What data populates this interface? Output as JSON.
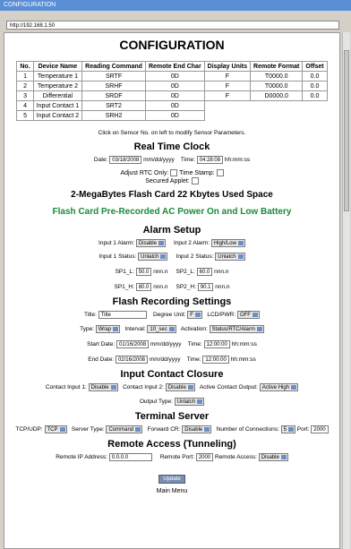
{
  "window": {
    "title": "CONFIGURATION"
  },
  "address": {
    "url": "http://192.168.1.50"
  },
  "page_title": "CONFIGURATION",
  "sensors": {
    "headers": [
      "No.",
      "Device Name",
      "Reading Command",
      "Remote End Char",
      "Display Units",
      "Remote Format",
      "Offset"
    ],
    "rows": [
      [
        "1",
        "Temperature 1",
        "SRTF",
        "0D",
        "F",
        "T0000.0",
        "0.0"
      ],
      [
        "2",
        "Temperature 2",
        "SRHF",
        "0D",
        "F",
        "T0000.0",
        "0.0"
      ],
      [
        "3",
        "Differential",
        "SRDF",
        "0D",
        "F",
        "D0000.0",
        "0.0"
      ],
      [
        "4",
        "Input Contact 1",
        "SRT2",
        "0D"
      ],
      [
        "5",
        "Input Contact 2",
        "SRH2",
        "0D"
      ]
    ],
    "note": "Click on Sensor No. on left to modify Sensor Parameters."
  },
  "rtc": {
    "title": "Real Time Clock",
    "date_label": "Date:",
    "date_value": "03/18/2008",
    "date_fmt": "mm/dd/yyyy",
    "time_label": "Time:",
    "time_value": "04:28:08",
    "time_fmt": "hh:mm:ss",
    "adjust_label": "Adjust RTC Only:",
    "timestamp_label": "Time Stamp:",
    "secured_label": "Secured Applet:"
  },
  "flash_info": "2-MegaBytes Flash Card 22 Kbytes Used Space",
  "flash_prerecorded": "Flash Card Pre-Recorded AC Power On and Low Battery",
  "alarm": {
    "title": "Alarm Setup",
    "in1_alarm_label": "Input 1 Alarm:",
    "in1_alarm": "Disable",
    "in2_alarm_label": "Input 2 Alarm:",
    "in2_alarm": "High/Low",
    "in1_status_label": "Input 1 Status:",
    "in1_status": "Unlatch",
    "in2_status_label": "Input 2 Status:",
    "in2_status": "Unlatch",
    "sp1_l_label": "SP1_L:",
    "sp1_l": "50.0",
    "sp2_l_label": "SP2_L:",
    "sp2_l": "60.0",
    "sp1_h_label": "SP1_H:",
    "sp1_h": "80.0",
    "sp2_h_label": "SP2_H:",
    "sp2_h": "90.1",
    "unit": "nnn.n"
  },
  "flash_rec": {
    "title": "Flash Recording Settings",
    "title_label": "Title:",
    "title_value": "Title",
    "degree_label": "Degree Unit:",
    "degree_value": "F",
    "lcd_label": "LCD/PWR:",
    "lcd_value": "OFF",
    "type_label": "Type:",
    "type_value": "Wrap",
    "interval_label": "Interval:",
    "interval_value": "10_sec",
    "activation_label": "Activation:",
    "activation_value": "Status/RTC/Alarm",
    "start_label": "Start Date:",
    "start_date": "01/16/2008",
    "start_time": "12:00:00",
    "end_label": "End Date:",
    "end_date": "02/16/2008",
    "end_time": "12:00:00",
    "date_fmt": "mm/dd/yyyy",
    "time_label": "Time:",
    "time_fmt": "hh:mm:ss"
  },
  "contact": {
    "title": "Input Contact Closure",
    "c1_label": "Contact Input 1:",
    "c1": "Disable",
    "c2_label": "Contact Input 2:",
    "c2": "Disable",
    "active_label": "Active Contact Output:",
    "active": "Active High",
    "output_label": "Output Type:",
    "output": "Unlatch"
  },
  "terminal": {
    "title": "Terminal Server",
    "tcp_label": "TCP/UDP:",
    "tcp": "TCP",
    "server_label": "Server Type:",
    "server": "Command",
    "fcr_label": "Forward CR:",
    "fcr": "Disable",
    "conn_label": "Number of Connections:",
    "conn": "5",
    "port_label": "Port:",
    "port": "2000"
  },
  "remote": {
    "title": "Remote Access (Tunneling)",
    "ip_label": "Remote IP Address:",
    "ip": "0.0.0.0",
    "port_label": "Remote Port:",
    "port": "2000",
    "access_label": "Remote Access:",
    "access": "Disable"
  },
  "update_label": "Update",
  "main_menu": "Main Menu"
}
